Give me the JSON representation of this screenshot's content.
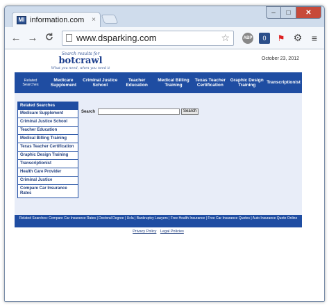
{
  "browser": {
    "tab_title": "information.com",
    "tab_close": "×",
    "favicon_text": "MI",
    "url": "www.dsparking.com",
    "window_controls": {
      "minimize": "–",
      "maximize": "□",
      "close": "✕"
    },
    "nav": {
      "back": "←",
      "forward": "→",
      "reload": "C"
    },
    "icons": [
      "page-icon",
      "star-icon",
      "adblock-icon",
      "shield-icon",
      "flag-icon",
      "gear-icon",
      "menu-icon"
    ],
    "ext_abp_text": "ABP",
    "ext_shield_text": "0"
  },
  "page": {
    "logo": {
      "tagline": "Search results for",
      "name": "botcrawl",
      "sub": "What you need, when you need it"
    },
    "date": "October 23, 2012",
    "navstrip": {
      "label": "Related Searches",
      "items": [
        "Medicare Supplement",
        "Criminal Justice School",
        "Teacher Education",
        "Medical Billing Training",
        "Texas Teacher Certification",
        "Graphic Design Training",
        "Transcriptionist"
      ]
    },
    "related": {
      "heading": "Related Searches",
      "items": [
        "Medicare Supplement",
        "Criminal Justice School",
        "Teacher Education",
        "Medical Billing Training",
        "Texas Teacher Certification",
        "Graphic Design Training",
        "Transcriptionist",
        "Health Care Provider",
        "Criminal Justice",
        "Compare Car Insurance Rates"
      ]
    },
    "search": {
      "label": "Search",
      "value": "",
      "button": "Search"
    },
    "footer_bar": "Related Searches: Compare Car Insurance Rates | Doctoral Degree | Ucla | Bankruptcy Lawyers | Free Health Insurance | Free Car Insurance Quotes | Auto Insurance Quote Online",
    "footer_links": [
      "Privacy Policy",
      "Legal Policies"
    ]
  },
  "colors": {
    "brand_blue": "#1f4da2",
    "content_bg": "#e8edf8",
    "window_frame": "#cfdcec",
    "close_red": "#c74a3a"
  }
}
